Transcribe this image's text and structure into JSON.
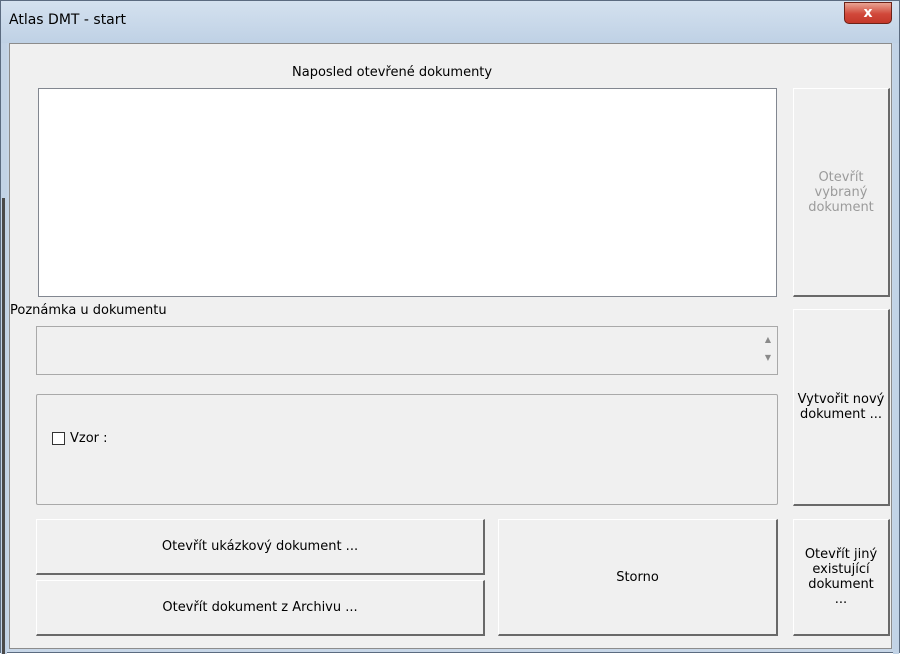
{
  "window": {
    "title": "Atlas DMT - start",
    "close_glyph": "x"
  },
  "recent": {
    "label": "Naposled otevřené dokumenty",
    "items": []
  },
  "buttons": {
    "open_selected": "Otevřít vybraný dokument",
    "create_new": "Vytvořit nový dokument ...",
    "open_other": "Otevřít jiný existující dokument ...",
    "open_sample": "Otevřít ukázkový dokument ...",
    "open_archive": "Otevřít dokument z Archivu ...",
    "cancel": "Storno"
  },
  "note": {
    "label": "Poznámka u dokumentu",
    "value": ""
  },
  "template": {
    "checkbox_label": "Vzor :",
    "checked": false
  },
  "icons": {
    "close": "close-icon",
    "scroll_up": "scroll-up-icon",
    "scroll_down": "scroll-down-icon"
  }
}
